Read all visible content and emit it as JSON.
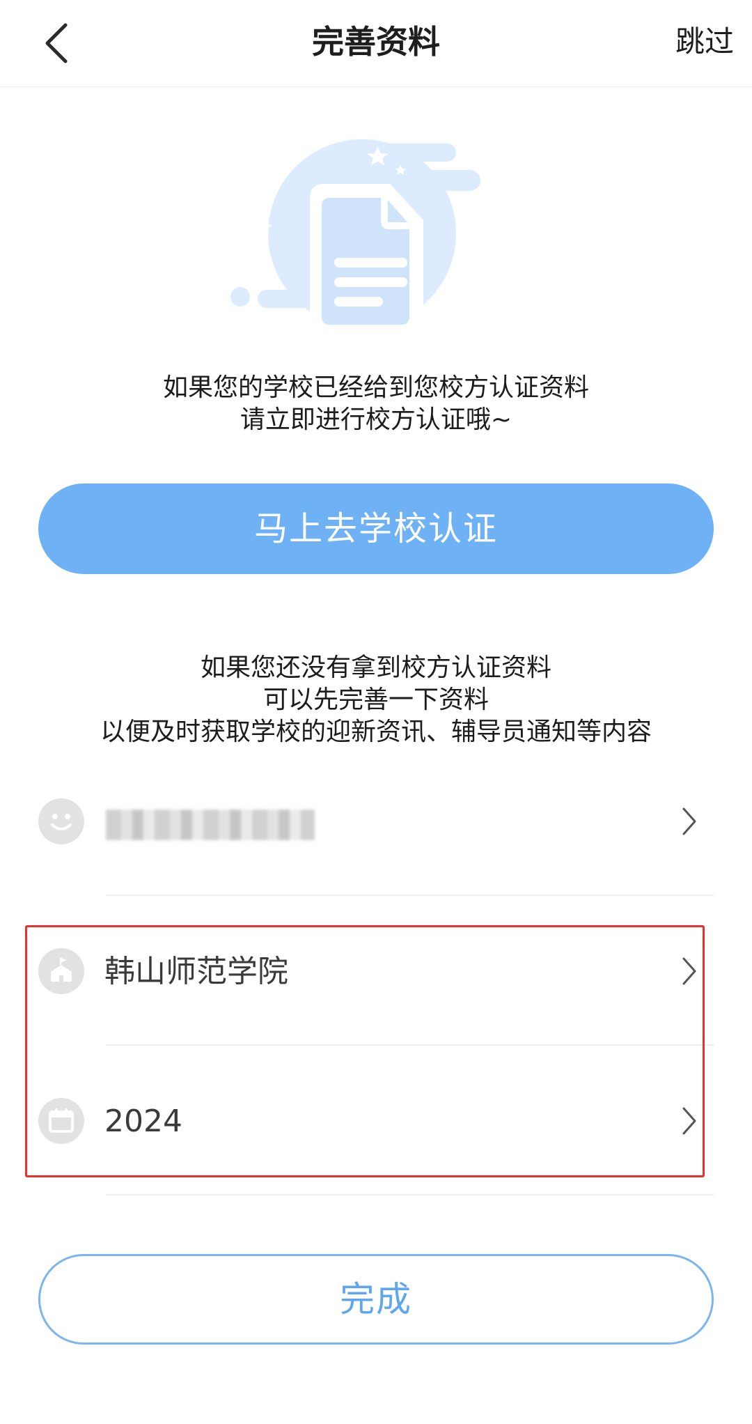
{
  "header": {
    "title": "完善资料",
    "skip_label": "跳过"
  },
  "intro1": {
    "line1": "如果您的学校已经给到您校方认证资料",
    "line2": "请立即进行校方认证哦~"
  },
  "verify_button_label": "马上去学校认证",
  "intro2": {
    "line1": "如果您还没有拿到校方认证资料",
    "line2": "可以先完善一下资料",
    "line3": "以便及时获取学校的迎新资讯、辅导员通知等内容"
  },
  "rows": [
    {
      "icon": "smiley-icon",
      "value": ""
    },
    {
      "icon": "school-building-icon",
      "value": "韩山师范学院"
    },
    {
      "icon": "calendar-icon",
      "value": "2024"
    }
  ],
  "done_button_label": "完成",
  "colors": {
    "accent": "#6fb1f5",
    "done_text": "#5ea6ee",
    "highlight": "#e8302c",
    "icon_bg": "#e2e2e2"
  }
}
